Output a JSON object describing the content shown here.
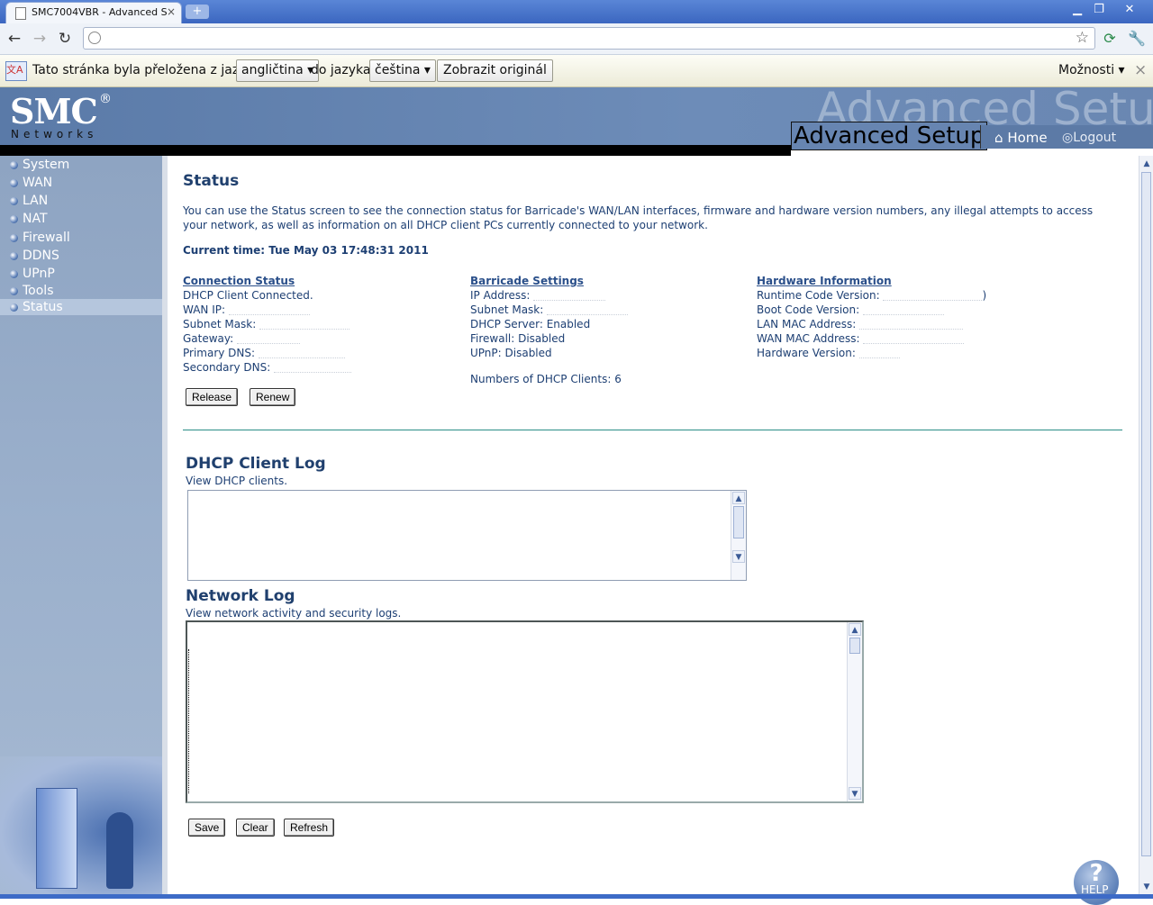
{
  "browser": {
    "tab_title": "SMC7004VBR - Advanced S...",
    "tab_close": "×",
    "new_tab": "+",
    "window_minimize": "▁",
    "window_restore": "❐",
    "window_close": "✕"
  },
  "translate_bar": {
    "message_prefix": "Tato stránka byla přeložena z jazyka",
    "from_language": "angličtina",
    "message_mid": "do jazyka",
    "to_language": "čeština",
    "show_original": "Zobrazit originál",
    "options": "Možnosti",
    "close": "×"
  },
  "header": {
    "logo": "SMC",
    "logo_reg": "®",
    "logo_sub": "Networks",
    "watermark": "Advanced Setup",
    "title": "Advanced Setup",
    "home": "Home",
    "logout": "Logout"
  },
  "sidebar": {
    "items": [
      {
        "label": "System"
      },
      {
        "label": "WAN"
      },
      {
        "label": "LAN"
      },
      {
        "label": "NAT"
      },
      {
        "label": "Firewall"
      },
      {
        "label": "DDNS"
      },
      {
        "label": "UPnP"
      },
      {
        "label": "Tools"
      },
      {
        "label": "Status"
      }
    ]
  },
  "status": {
    "title": "Status",
    "intro": "You can use the Status screen to see the connection status for Barricade's WAN/LAN interfaces, firmware and hardware version numbers, any illegal attempts to access your network, as well as information on all DHCP client PCs currently connected to your network.",
    "current_time": "Current time: Tue May 03 17:48:31 2011",
    "connection": {
      "heading": "Connection Status",
      "rows": [
        "DHCP Client Connected.",
        "WAN IP:",
        "Subnet Mask:",
        "Gateway:",
        "Primary DNS:",
        "Secondary DNS:"
      ]
    },
    "barricade": {
      "heading": "Barricade Settings",
      "rows": [
        "IP Address:",
        "Subnet Mask:",
        "DHCP Server: Enabled",
        "Firewall: Disabled",
        "UPnP: Disabled"
      ],
      "dhcp_clients": "Numbers of DHCP Clients: 6"
    },
    "hardware": {
      "heading": "Hardware Information",
      "rows": [
        "Runtime Code Version:",
        "Boot Code Version:",
        "LAN MAC Address:",
        "WAN MAC Address:",
        "Hardware Version:"
      ],
      "runtime_suffix": ")"
    },
    "release": "Release",
    "renew": "Renew"
  },
  "dhcp_log": {
    "title": "DHCP Client Log",
    "subtitle": "View DHCP clients."
  },
  "network_log": {
    "title": "Network Log",
    "subtitle": "View network activity and security logs.",
    "save": "Save",
    "clear": "Clear",
    "refresh": "Refresh"
  },
  "help": {
    "mark": "?",
    "label": "HELP"
  }
}
